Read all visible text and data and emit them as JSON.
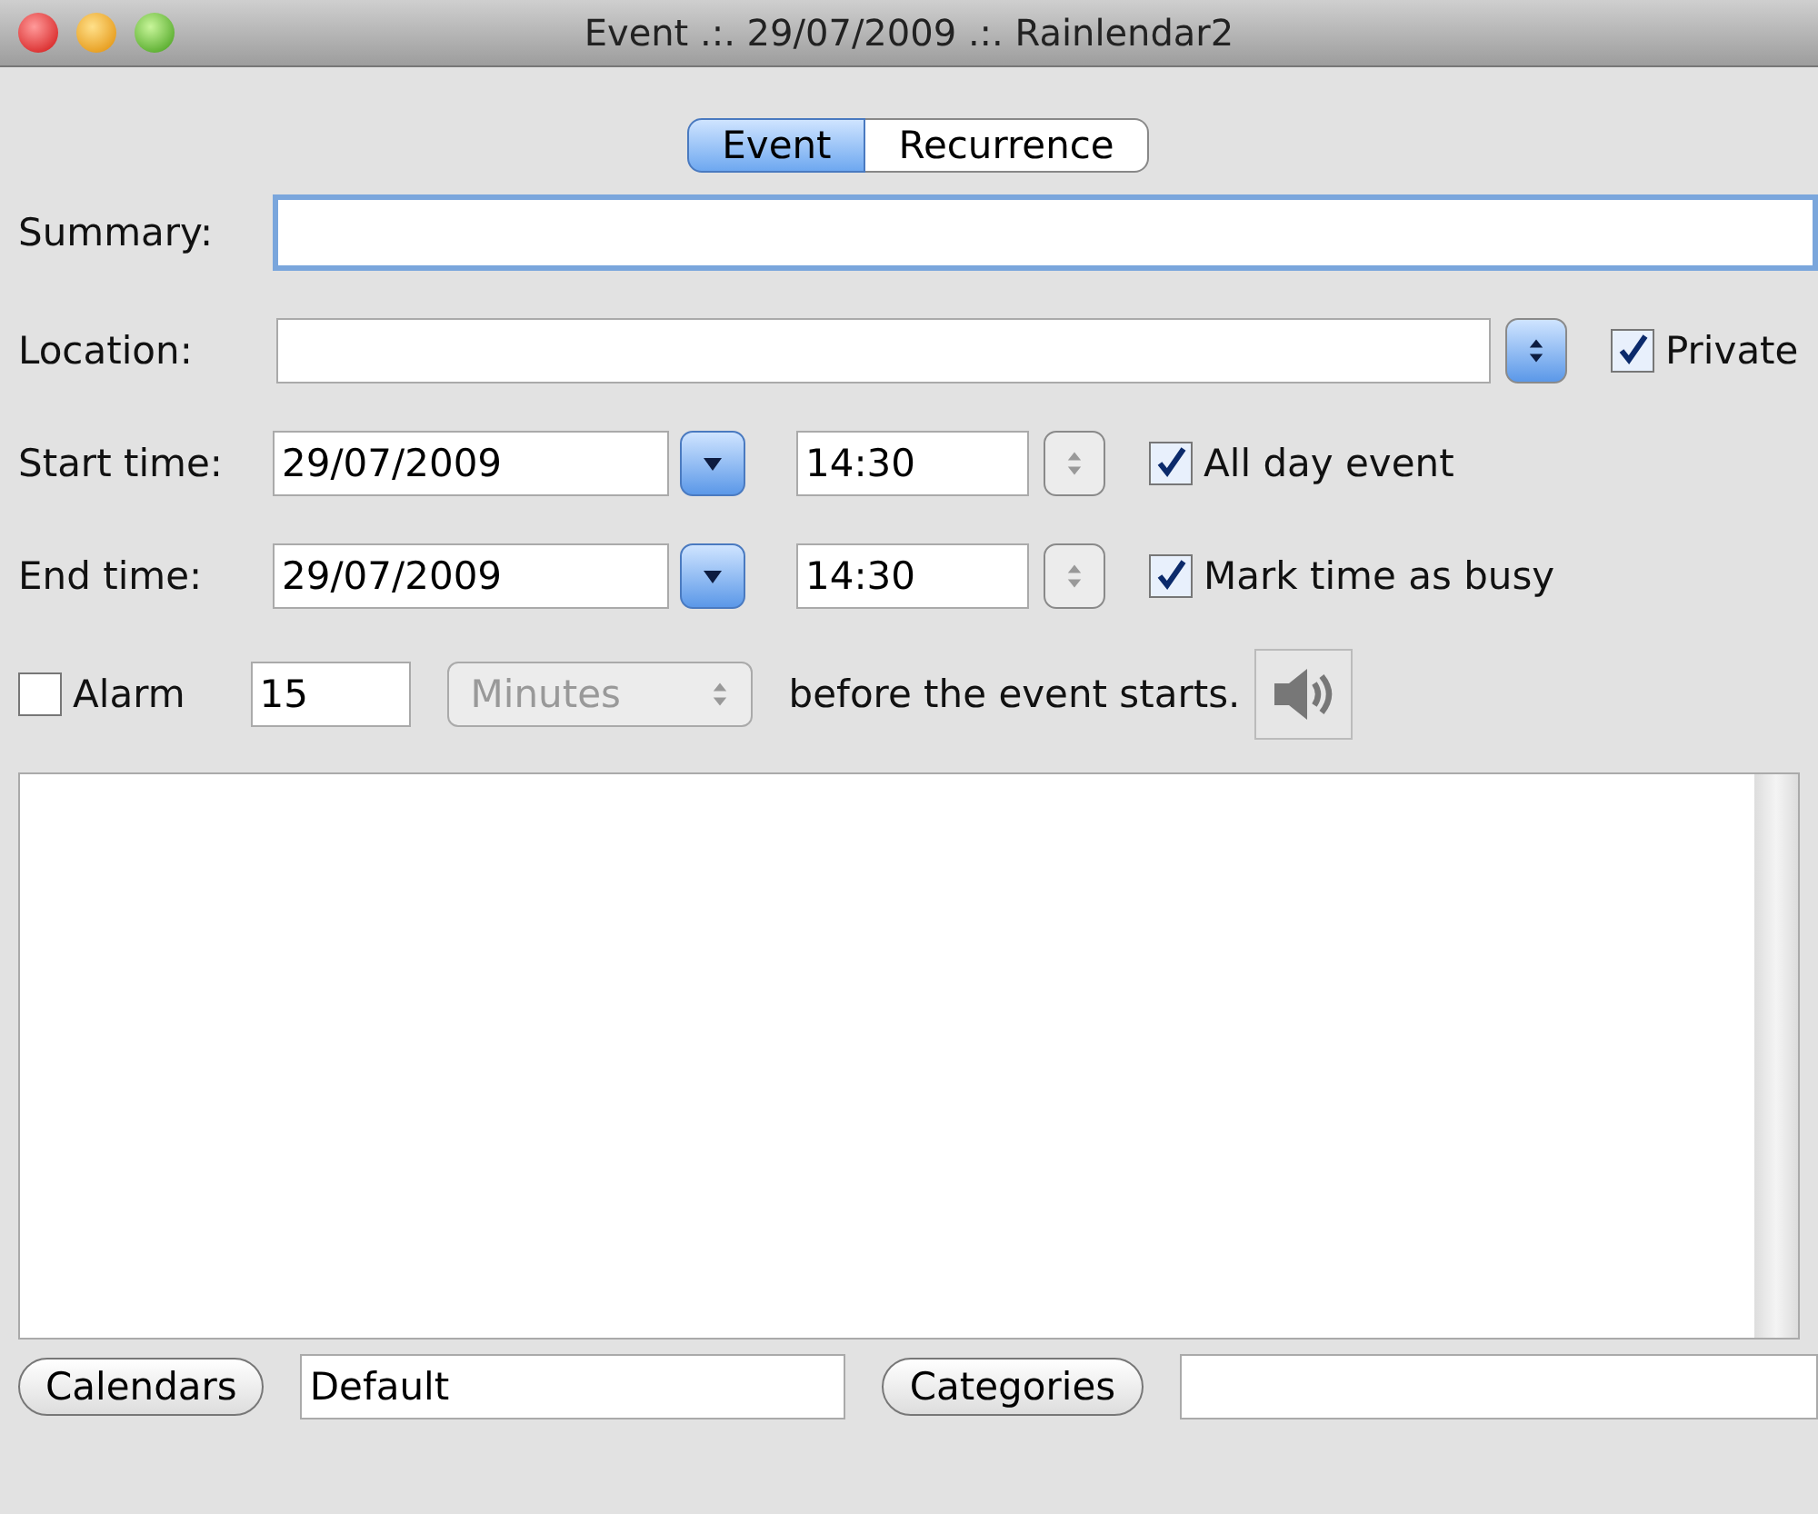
{
  "window": {
    "title": "Event .:. 29/07/2009 .:. Rainlendar2"
  },
  "tabs": [
    {
      "label": "Event",
      "selected": true
    },
    {
      "label": "Recurrence",
      "selected": false
    }
  ],
  "summary": {
    "label": "Summary:",
    "focused": true
  },
  "location": {
    "label": "Location:"
  },
  "private": {
    "label": "Private",
    "checked": true
  },
  "start": {
    "label": "Start time:",
    "date": "29/07/2009",
    "time": "14:30"
  },
  "all_day": {
    "label": "All day event",
    "checked": true
  },
  "end": {
    "label": "End time:",
    "date": "29/07/2009",
    "time": "14:30"
  },
  "busy": {
    "label": "Mark time as busy",
    "checked": true
  },
  "alarm": {
    "label": "Alarm",
    "checked": false,
    "amount": "15",
    "unit": "Minutes",
    "unit_disabled": true,
    "suffix": "before the event starts."
  },
  "footer": {
    "calendars_button": "Calendars",
    "calendar": "Default",
    "categories_button": "Categories"
  }
}
